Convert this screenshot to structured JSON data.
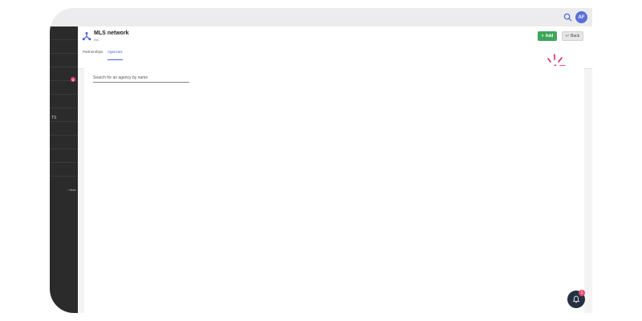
{
  "topbar": {
    "avatar_initials": "AF"
  },
  "sidebar": {
    "badge_count": "8",
    "truncated_label": "TS",
    "hide_label": "‹ Hide"
  },
  "header": {
    "title": "MLS network",
    "subtitle": "INC",
    "add_label": "Add",
    "back_label": "Back",
    "tabs": [
      {
        "label": "Partnerships",
        "active": false
      },
      {
        "label": "Agencies",
        "active": true
      }
    ]
  },
  "main": {
    "search_placeholder": "Search for an agency by name"
  },
  "notifications": {
    "badge_count": "1"
  },
  "colors": {
    "accent": "#4a63cf",
    "add_button": "#3ea55a",
    "sidebar": "#2b2b2b",
    "badge": "#e84a6f",
    "cursor_highlight": "#e0245e"
  }
}
